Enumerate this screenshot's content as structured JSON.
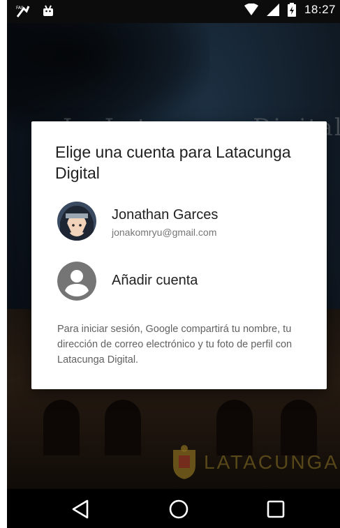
{
  "status_bar": {
    "time": "18:27",
    "icons": [
      "no-sim-notification-icon",
      "android-debug-icon",
      "wifi-icon",
      "cell-signal-icon",
      "battery-charging-icon"
    ]
  },
  "background_app": {
    "faded_title": "La Latacunga Digital",
    "logo_text": "LATACUNGA"
  },
  "dialog": {
    "title": "Elige una cuenta para Latacunga Digital",
    "accounts": [
      {
        "name": "Jonathan Garces",
        "email": "jonakomryu@gmail.com"
      }
    ],
    "add_account_label": "Añadir cuenta",
    "note": "Para iniciar sesión, Google compartirá tu nombre, tu dirección de correo electrónico y tu foto de perfil con Latacunga Digital."
  },
  "nav_bar": {
    "buttons": [
      "back-icon",
      "home-icon",
      "recents-icon"
    ]
  },
  "colors": {
    "dialog_bg": "#ffffff",
    "title_text": "#212121",
    "secondary_text": "#757575",
    "default_avatar": "#757575"
  }
}
